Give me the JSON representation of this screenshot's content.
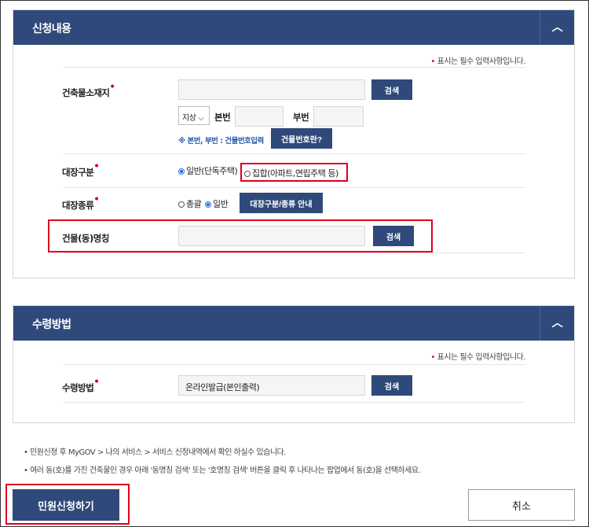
{
  "section1": {
    "title": "신청내용",
    "toggle": "︿",
    "required_note": "표시는 필수 입력사항입니다.",
    "address_label": "건축물소재지",
    "search": "검색",
    "lot_select": "지상",
    "main_no": "본번",
    "sub_no": "부번",
    "hint": "※ 본번, 부번 : 건물번호입력",
    "building_no_btn": "건물번호란?",
    "type_label": "대장구분",
    "type_opt1": "일반(단독주택)",
    "type_opt2": "집합(아파트,연립주택 등)",
    "kind_label": "대장종류",
    "kind_opt1": "총괄",
    "kind_opt2": "일반",
    "kind_btn": "대장구분/종류 안내",
    "dong_label": "건물(동)명칭",
    "dong_search": "검색"
  },
  "section2": {
    "title": "수령방법",
    "toggle": "︿",
    "required_note": "표시는 필수 입력사항입니다.",
    "label": "수령방법",
    "value": "온라인발급(본인출력)",
    "search": "검색"
  },
  "notes": [
    "민원신청 후 MyGOV > 나의 서비스 > 서비스 신청내역에서 확인 하실수 있습니다.",
    "여러 동(호)를 가진 건축물인 경우 아래 '동명칭 검색' 또는 '호명칭 검색' 버튼을 클릭 후 나타나는 팝업에서 동(호)을 선택하세요."
  ],
  "submit": "민원신청하기",
  "cancel": "취소"
}
